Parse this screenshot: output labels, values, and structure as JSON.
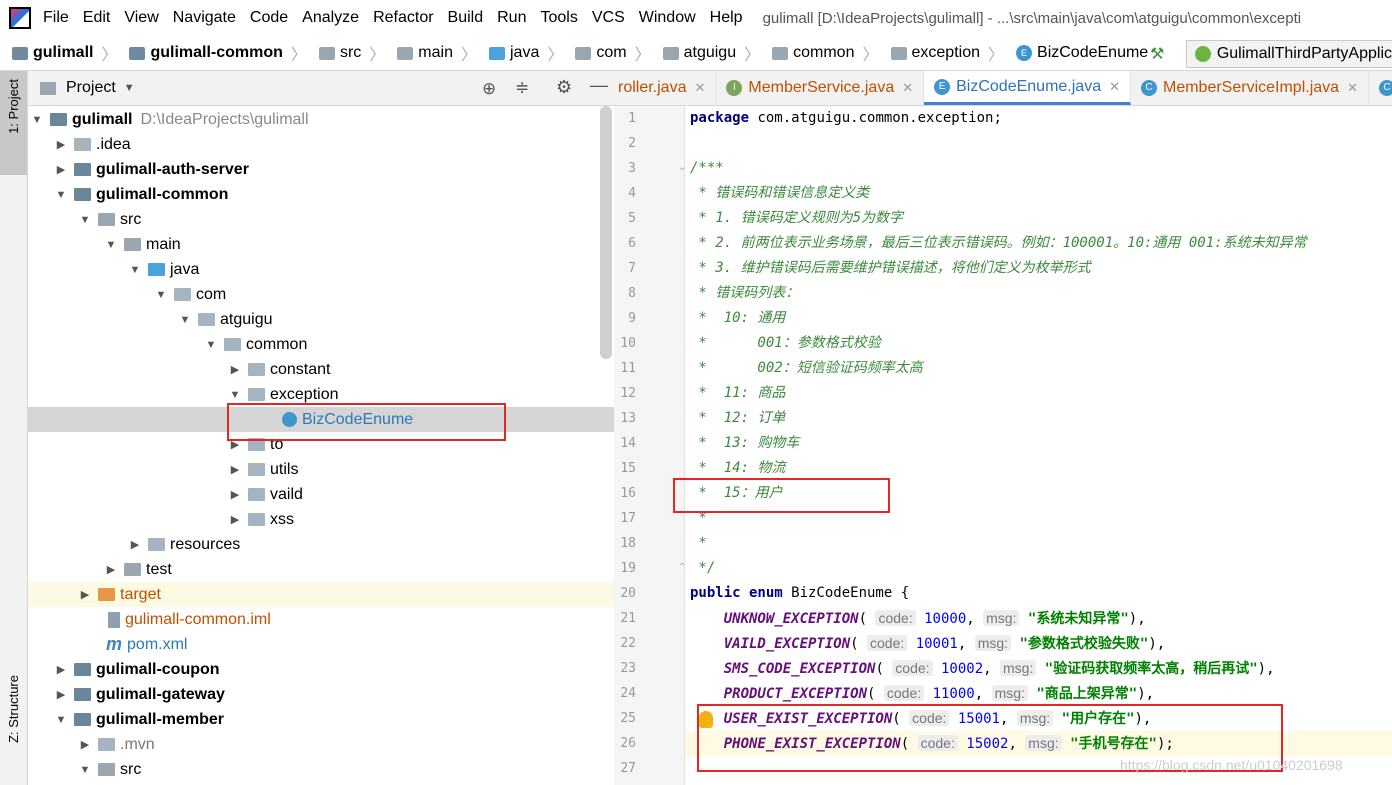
{
  "menu": {
    "items": [
      "File",
      "Edit",
      "View",
      "Navigate",
      "Code",
      "Analyze",
      "Refactor",
      "Build",
      "Run",
      "Tools",
      "VCS",
      "Window",
      "Help"
    ],
    "window_title": "gulimall [D:\\IdeaProjects\\gulimall] - ...\\src\\main\\java\\com\\atguigu\\common\\excepti"
  },
  "breadcrumbs": [
    "gulimall",
    "gulimall-common",
    "src",
    "main",
    "java",
    "com",
    "atguigu",
    "common",
    "exception",
    "BizCodeEnume"
  ],
  "run_config": "GulimallThirdPartyApplic",
  "project_panel": {
    "title": "Project",
    "side_tab_project": "1: Project",
    "side_tab_structure": "Z: Structure"
  },
  "tree": [
    {
      "label": "gulimall",
      "extra": "D:\\IdeaProjects\\gulimall",
      "bold": true
    },
    {
      "label": ".idea"
    },
    {
      "label": "gulimall-auth-server",
      "bold": true
    },
    {
      "label": "gulimall-common",
      "bold": true
    },
    {
      "label": "src"
    },
    {
      "label": "main"
    },
    {
      "label": "java"
    },
    {
      "label": "com"
    },
    {
      "label": "atguigu"
    },
    {
      "label": "common"
    },
    {
      "label": "constant"
    },
    {
      "label": "exception"
    },
    {
      "label": "BizCodeEnume"
    },
    {
      "label": "to"
    },
    {
      "label": "utils"
    },
    {
      "label": "vaild"
    },
    {
      "label": "xss"
    },
    {
      "label": "resources"
    },
    {
      "label": "test"
    },
    {
      "label": "target"
    },
    {
      "label": "gulimall-common.iml"
    },
    {
      "label": "pom.xml"
    },
    {
      "label": "gulimall-coupon",
      "bold": true
    },
    {
      "label": "gulimall-gateway",
      "bold": true
    },
    {
      "label": "gulimall-member",
      "bold": true
    },
    {
      "label": ".mvn"
    },
    {
      "label": "src"
    }
  ],
  "tabs": [
    "roller.java",
    "MemberService.java",
    "BizCodeEnume.java",
    "MemberServiceImpl.java",
    "U"
  ],
  "line_numbers": [
    "1",
    "2",
    "3",
    "4",
    "5",
    "6",
    "7",
    "8",
    "9",
    "10",
    "11",
    "12",
    "13",
    "14",
    "15",
    "16",
    "17",
    "18",
    "19",
    "20",
    "21",
    "22",
    "23",
    "24",
    "25",
    "26",
    "27"
  ],
  "code": {
    "l1_kw": "package",
    "l1_rest": " com.atguigu.common.exception;",
    "l3": "/***",
    "l4": " * 错误码和错误信息定义类",
    "l5": " * 1. 错误码定义规则为5为数字",
    "l6": " * 2. 前两位表示业务场景，最后三位表示错误码。例如：100001。10:通用 001:系统未知异常",
    "l7": " * 3. 维护错误码后需要维护错误描述，将他们定义为枚举形式",
    "l8": " * 错误码列表：",
    "l9": " *  10: 通用",
    "l10": " *      001：参数格式校验",
    "l11": " *      002：短信验证码频率太高",
    "l12": " *  11: 商品",
    "l13": " *  12: 订单",
    "l14": " *  13: 购物车",
    "l15": " *  14: 物流",
    "l16": " *  15：用户",
    "l17": " *",
    "l18": " *",
    "l19": " */",
    "l20_kw": "public enum",
    "l20_rest": " BizCodeEnume {",
    "hint_code": "code:",
    "hint_msg": "msg:",
    "enums": [
      {
        "name": "UNKNOW_EXCEPTION",
        "code": "10000",
        "msg": "\"系统未知异常\"",
        "end": "),"
      },
      {
        "name": "VAILD_EXCEPTION",
        "code": "10001",
        "msg": "\"参数格式校验失败\"",
        "end": "),"
      },
      {
        "name": "SMS_CODE_EXCEPTION",
        "code": "10002",
        "msg": "\"验证码获取频率太高，稍后再试\"",
        "end": "),"
      },
      {
        "name": "PRODUCT_EXCEPTION",
        "code": "11000",
        "msg": "\"商品上架异常\"",
        "end": "),"
      },
      {
        "name": "USER_EXIST_EXCEPTION",
        "code": "15001",
        "msg": "\"用户存在\"",
        "end": "),"
      },
      {
        "name": "PHONE_EXIST_EXCEPTION",
        "code": "15002",
        "msg": "\"手机号存在\"",
        "end": ");"
      }
    ]
  },
  "watermark": "https://blog.csdn.net/u01040201698"
}
